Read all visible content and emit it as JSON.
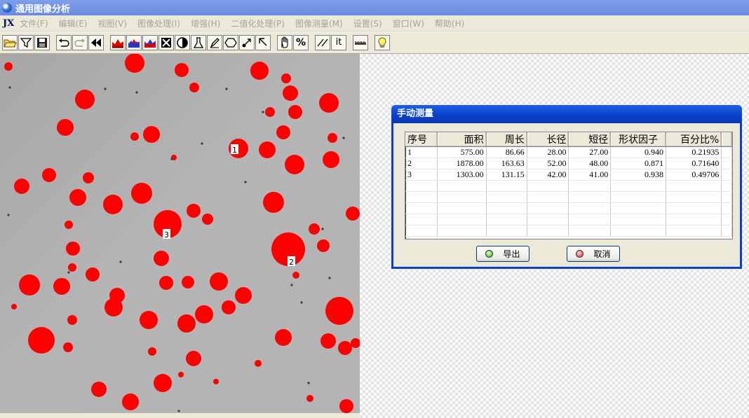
{
  "window": {
    "title": "通用图像分析"
  },
  "menubar": {
    "logo": "JX",
    "items": [
      {
        "label": "文件(F)"
      },
      {
        "label": "编辑(E)"
      },
      {
        "label": "视图(V)"
      },
      {
        "label": "图像处理(I)"
      },
      {
        "label": "增强(H)"
      },
      {
        "label": "二值化处理(P)"
      },
      {
        "label": "图像测量(M)"
      },
      {
        "label": "设置(S)"
      },
      {
        "label": "窗口(W)"
      },
      {
        "label": "帮助(H)"
      }
    ]
  },
  "toolbar": {
    "icons": [
      "open-folder-icon",
      "filter-icon",
      "save-disk-icon",
      "undo-icon",
      "redo-icon",
      "rewind-icon",
      "histogram-icon",
      "histogram-icon",
      "histogram-icon",
      "crop-icon",
      "contrast-icon",
      "flask-icon",
      "pen-icon",
      "hexagon-icon",
      "move-point-icon",
      "pointer-arrow-icon",
      "hand-icon",
      "percent-icon",
      "parallel-lines-icon",
      "count-icon",
      "ruler-icon",
      "lightbulb-icon"
    ],
    "percent_label": "%",
    "count_label": "it"
  },
  "image": {
    "markers": [
      {
        "label": "1"
      },
      {
        "label": "2"
      },
      {
        "label": "3"
      }
    ],
    "colors": {
      "particle": "#ff0000",
      "background": "#b0b0b0"
    }
  },
  "dialog": {
    "title": "手动测量",
    "columns": [
      "序号",
      "面积",
      "周长",
      "长径",
      "短径",
      "形状因子",
      "百分比%"
    ],
    "rows": [
      [
        "1",
        "575.00",
        "86.66",
        "28.00",
        "27.00",
        "0.940",
        "0.21935"
      ],
      [
        "2",
        "1878.00",
        "163.63",
        "52.00",
        "48.00",
        "0.871",
        "0.71640"
      ],
      [
        "3",
        "1303.00",
        "131.15",
        "42.00",
        "41.00",
        "0.938",
        "0.49706"
      ]
    ],
    "export_label": "导出",
    "cancel_label": "取消"
  }
}
